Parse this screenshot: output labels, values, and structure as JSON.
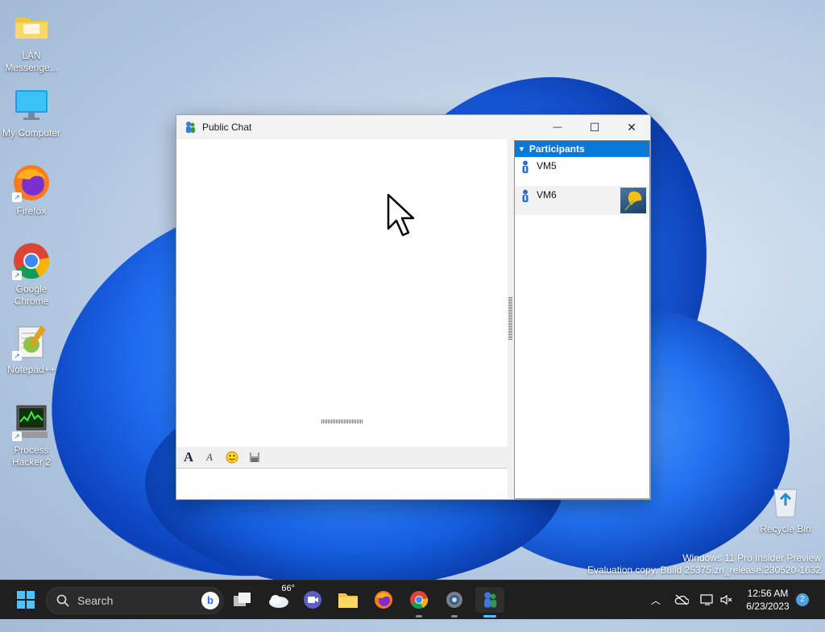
{
  "desktop": {
    "icons": [
      {
        "label": "LAN Messenge..."
      },
      {
        "label": "My Computer"
      },
      {
        "label": "Firefox"
      },
      {
        "label": "Google Chrome"
      },
      {
        "label": "Notepad++"
      },
      {
        "label": "Process Hacker 2"
      },
      {
        "label": "Recycle Bin"
      }
    ],
    "watermark_line1": "Windows 11 Pro Insider Preview",
    "watermark_line2": "Evaluation copy. Build 25375.zn_release.230520-1632"
  },
  "window": {
    "title": "Public Chat",
    "minimize_glyph": "—",
    "maximize_glyph": "☐",
    "close_glyph": "✕",
    "participants_header": "Participants",
    "participants": [
      {
        "name": "VM5",
        "has_avatar": false
      },
      {
        "name": "VM6",
        "has_avatar": true
      }
    ],
    "toolbar": {
      "font_button": "A",
      "font_style_button": "A",
      "emoji_button": "☺",
      "save_button": "save"
    },
    "message_input_value": ""
  },
  "taskbar": {
    "search_placeholder": "Search",
    "weather_temp": "66°",
    "time": "12:56 AM",
    "date": "6/23/2023",
    "notification_count": "2"
  }
}
